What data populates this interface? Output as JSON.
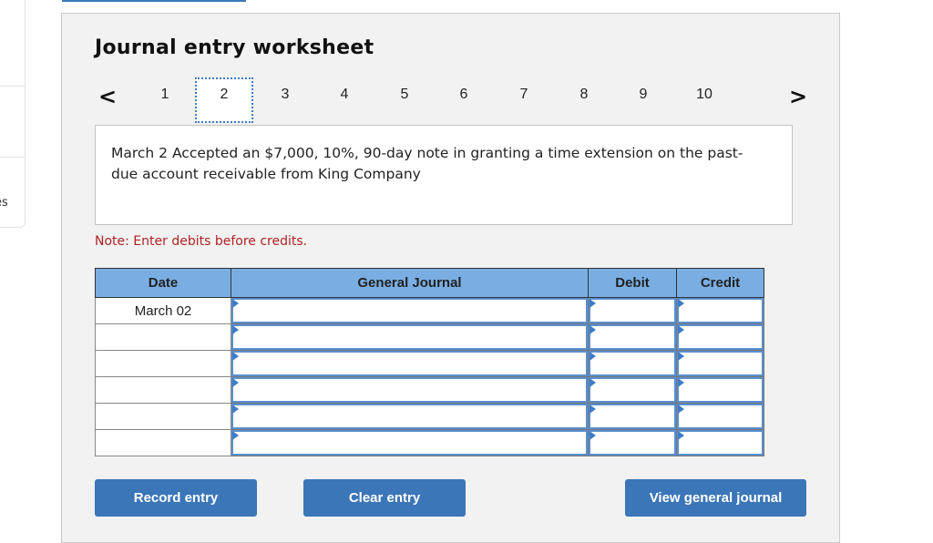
{
  "sidebar": {
    "partial_label": "es"
  },
  "worksheet": {
    "title": "Journal entry worksheet",
    "pager": {
      "prev_icon": "chevron-left-icon",
      "next_icon": "chevron-right-icon",
      "prev_glyph": "<",
      "next_glyph": ">",
      "pages": [
        "1",
        "2",
        "3",
        "4",
        "5",
        "6",
        "7",
        "8",
        "9",
        "10"
      ],
      "active_page": "2"
    },
    "question": "March 2 Accepted an $7,000, 10%, 90-day note in granting a time extension on the past-due account receivable from King Company",
    "note": "Note: Enter debits before credits.",
    "table": {
      "headers": {
        "date": "Date",
        "general_journal": "General Journal",
        "debit": "Debit",
        "credit": "Credit"
      },
      "rows": [
        {
          "date": "March 02",
          "account": "",
          "debit": "",
          "credit": ""
        },
        {
          "date": "",
          "account": "",
          "debit": "",
          "credit": ""
        },
        {
          "date": "",
          "account": "",
          "debit": "",
          "credit": ""
        },
        {
          "date": "",
          "account": "",
          "debit": "",
          "credit": ""
        },
        {
          "date": "",
          "account": "",
          "debit": "",
          "credit": ""
        },
        {
          "date": "",
          "account": "",
          "debit": "",
          "credit": ""
        }
      ]
    },
    "buttons": {
      "record": "Record entry",
      "clear": "Clear entry",
      "view": "View general journal"
    }
  },
  "colors": {
    "accent": "#3b76b9",
    "header_bg": "#7aaee3",
    "note": "#b02222",
    "panel_bg": "#f2f2f2"
  }
}
